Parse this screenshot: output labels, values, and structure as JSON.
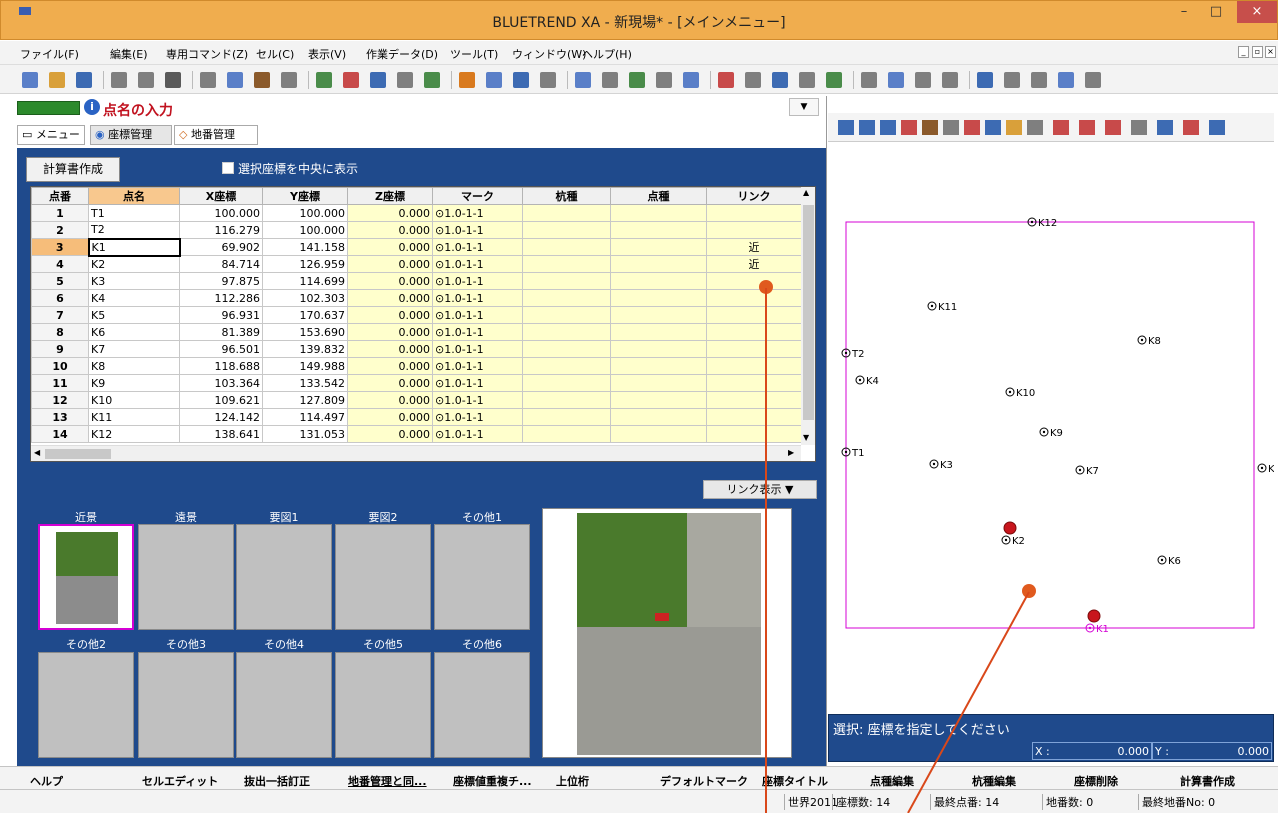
{
  "window": {
    "title": "BLUETREND XA - 新現場* - [メインメニュー]",
    "min": "–",
    "max": "□",
    "close": "×"
  },
  "menu": [
    "ファイル(F)",
    "編集(E)",
    "専用コマンド(Z)",
    "セル(C)",
    "表示(V)",
    "作業データ(D)",
    "ツール(T)",
    "ウィンドウ(W)",
    "ヘルプ(H)"
  ],
  "panel": {
    "title": "点名の入力",
    "info_icon": "i",
    "dropdown": "▼"
  },
  "tabs": [
    "メニュー",
    "座標管理",
    "地番管理"
  ],
  "calc_button": "計算書作成",
  "center_checkbox_label": "選択座標を中央に表示",
  "grid": {
    "headers": [
      "点番",
      "点名",
      "X座標",
      "Y座標",
      "Z座標",
      "マーク",
      "杭種",
      "点種",
      "リンク"
    ],
    "rows": [
      [
        "1",
        "T1",
        "100.000",
        "100.000",
        "0.000",
        "⊙1.0-1-1",
        "",
        "",
        ""
      ],
      [
        "2",
        "T2",
        "116.279",
        "100.000",
        "0.000",
        "⊙1.0-1-1",
        "",
        "",
        ""
      ],
      [
        "3",
        "K1",
        "69.902",
        "141.158",
        "0.000",
        "⊙1.0-1-1",
        "",
        "",
        "近"
      ],
      [
        "4",
        "K2",
        "84.714",
        "126.959",
        "0.000",
        "⊙1.0-1-1",
        "",
        "",
        "近"
      ],
      [
        "5",
        "K3",
        "97.875",
        "114.699",
        "0.000",
        "⊙1.0-1-1",
        "",
        "",
        ""
      ],
      [
        "6",
        "K4",
        "112.286",
        "102.303",
        "0.000",
        "⊙1.0-1-1",
        "",
        "",
        ""
      ],
      [
        "7",
        "K5",
        "96.931",
        "170.637",
        "0.000",
        "⊙1.0-1-1",
        "",
        "",
        ""
      ],
      [
        "8",
        "K6",
        "81.389",
        "153.690",
        "0.000",
        "⊙1.0-1-1",
        "",
        "",
        ""
      ],
      [
        "9",
        "K7",
        "96.501",
        "139.832",
        "0.000",
        "⊙1.0-1-1",
        "",
        "",
        ""
      ],
      [
        "10",
        "K8",
        "118.688",
        "149.988",
        "0.000",
        "⊙1.0-1-1",
        "",
        "",
        ""
      ],
      [
        "11",
        "K9",
        "103.364",
        "133.542",
        "0.000",
        "⊙1.0-1-1",
        "",
        "",
        ""
      ],
      [
        "12",
        "K10",
        "109.621",
        "127.809",
        "0.000",
        "⊙1.0-1-1",
        "",
        "",
        ""
      ],
      [
        "13",
        "K11",
        "124.142",
        "114.497",
        "0.000",
        "⊙1.0-1-1",
        "",
        "",
        ""
      ],
      [
        "14",
        "K12",
        "138.641",
        "131.053",
        "0.000",
        "⊙1.0-1-1",
        "",
        "",
        ""
      ]
    ],
    "selected_row": 3
  },
  "link_button": "リンク表示 ▼",
  "thumbnails": {
    "row1": [
      "近景",
      "遠景",
      "要図1",
      "要図2",
      "その他1"
    ],
    "row2": [
      "その他2",
      "その他3",
      "その他4",
      "その他5",
      "その他6"
    ]
  },
  "map_points": [
    {
      "label": "K12"
    },
    {
      "label": "K11"
    },
    {
      "label": "K8"
    },
    {
      "label": "T2"
    },
    {
      "label": "K4"
    },
    {
      "label": "K10"
    },
    {
      "label": "K9"
    },
    {
      "label": "T1"
    },
    {
      "label": "K3"
    },
    {
      "label": "K7"
    },
    {
      "label": "K"
    },
    {
      "label": "K2"
    },
    {
      "label": "K6"
    },
    {
      "label": "K1"
    }
  ],
  "status": {
    "message": "選択: 座標を指定してください",
    "x_label": "X :",
    "x_value": "0.000",
    "y_label": "Y :",
    "y_value": "0.000"
  },
  "function_keys": [
    "ヘルプ",
    "セルエディット",
    "抜出一括訂正",
    "地番管理と同...",
    "座標値重複チ...",
    "上位桁",
    "デフォルトマーク",
    "座標タイトル",
    "点種編集",
    "杭種編集",
    "座標削除",
    "計算書作成"
  ],
  "statusbar": {
    "system": "世界2011",
    "coord_count": "座標数:  14",
    "last_point": "最終点番:  14",
    "lot_count": "地番数:  0",
    "last_lot": "最終地番No:  0"
  },
  "colors": {
    "titlebar": "#f0ad4e",
    "panel_blue": "#1f4a8c",
    "boundary": "#d400d4",
    "title_red": "#c1121f",
    "annotation": "#e05a1e"
  }
}
